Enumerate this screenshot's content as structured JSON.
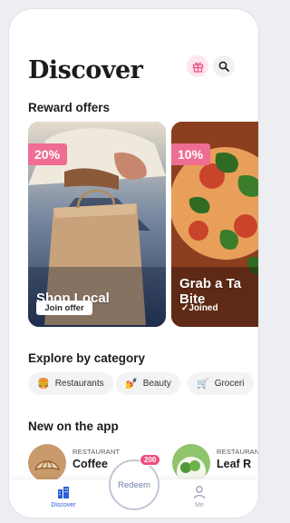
{
  "header": {
    "title": "Discover",
    "gift_icon": "gift-icon",
    "search_icon": "search-icon"
  },
  "rewards": {
    "title": "Reward offers",
    "cards": [
      {
        "badge": "20%",
        "name": "Shop Local",
        "action": "Join offer"
      },
      {
        "badge": "10%",
        "name_line1": "Grab a Ta",
        "name_line2": "Bite",
        "status": "✓Joined"
      }
    ]
  },
  "categories": {
    "title": "Explore by category",
    "items": [
      {
        "label": "Restaurants",
        "icon": "burger-icon"
      },
      {
        "label": "Beauty",
        "icon": "beauty-icon"
      },
      {
        "label": "Groceri",
        "icon": "cart-icon"
      }
    ]
  },
  "new_on_app": {
    "title": "New on the app",
    "items": [
      {
        "category": "RESTAURANT",
        "name": "Coffee"
      },
      {
        "category": "RESTAURANT",
        "name": "Leaf R"
      }
    ]
  },
  "tabbar": {
    "discover": "Discover",
    "redeem": "Redeem",
    "redeem_badge": "200",
    "me": "Me"
  },
  "colors": {
    "accent": "#ef6c93",
    "tab_active": "#2b5fd9",
    "tab_inactive": "#9aa0b5"
  }
}
